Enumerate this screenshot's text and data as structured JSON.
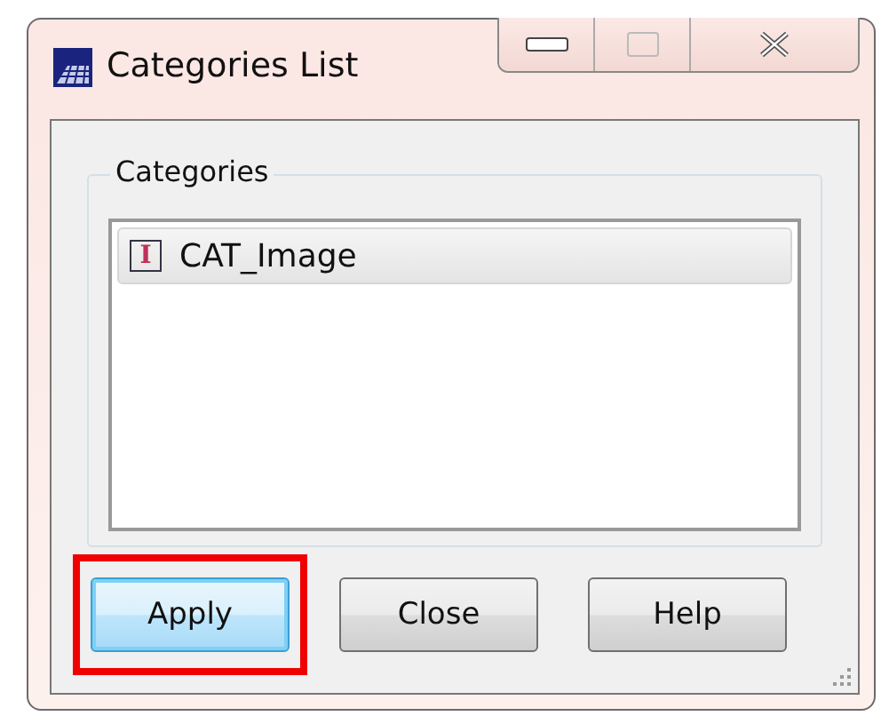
{
  "window": {
    "title": "Categories List"
  },
  "group": {
    "label": "Categories"
  },
  "list": {
    "items": [
      {
        "label": "CAT_Image",
        "icon_letter": "I",
        "selected": true
      }
    ]
  },
  "buttons": [
    {
      "label": "Apply",
      "focused": true,
      "highlighted": true
    },
    {
      "label": "Close",
      "focused": false,
      "highlighted": false
    },
    {
      "label": "Help",
      "focused": false,
      "highlighted": false
    }
  ]
}
